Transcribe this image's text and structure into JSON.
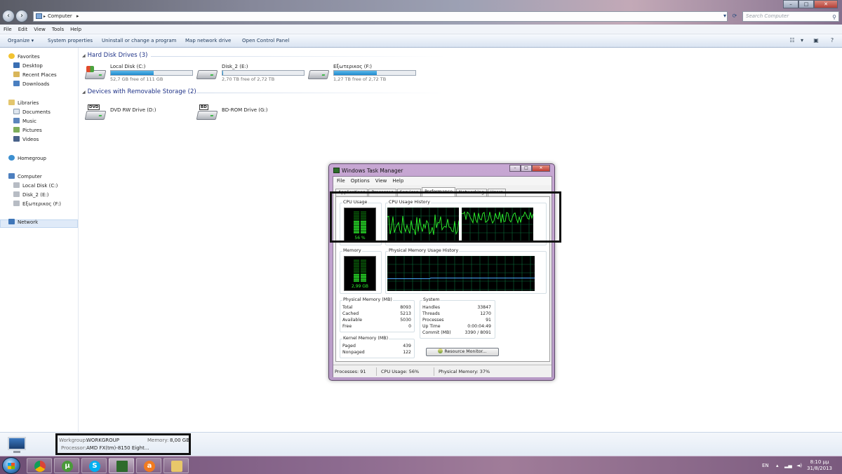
{
  "explorer": {
    "address": "Computer",
    "search_placeholder": "Search Computer",
    "menu": [
      "File",
      "Edit",
      "View",
      "Tools",
      "Help"
    ],
    "toolbar": {
      "organize": "Organize ▾",
      "system_properties": "System properties",
      "uninstall": "Uninstall or change a program",
      "map_drive": "Map network drive",
      "control_panel": "Open Control Panel"
    },
    "nav": {
      "favorites": "Favorites",
      "desktop": "Desktop",
      "recent": "Recent Places",
      "downloads": "Downloads",
      "libraries": "Libraries",
      "documents": "Documents",
      "music": "Music",
      "pictures": "Pictures",
      "videos": "Videos",
      "homegroup": "Homegroup",
      "computer": "Computer",
      "local_disk": "Local Disk (C:)",
      "disk2": "Disk_2 (E:)",
      "external": "Εξωτερικος (F:)",
      "network": "Network"
    },
    "groups": {
      "hdd": "Hard Disk Drives (3)",
      "removable": "Devices with Removable Storage (2)"
    },
    "drives": [
      {
        "name": "Local Disk (C:)",
        "free": "52,7 GB free of 111 GB",
        "used_fraction": 0.53
      },
      {
        "name": "Disk_2 (E:)",
        "free": "2,70 TB free of 2,72 TB",
        "used_fraction": 0.01
      },
      {
        "name": "Εξωτερικος (F:)",
        "free": "1,27 TB free of 2,72 TB",
        "used_fraction": 0.53
      }
    ],
    "removable": [
      {
        "name": "DVD RW Drive (D:)",
        "badge": "DVD"
      },
      {
        "name": "BD-ROM Drive (G:)",
        "badge": "BD"
      }
    ],
    "details": {
      "workgroup_label": "Workgroup:",
      "workgroup": "WORKGROUP",
      "memory_label": "Memory:",
      "memory": "8,00 GB",
      "processor_label": "Processor:",
      "processor": "AMD FX(tm)-8150 Eight..."
    }
  },
  "taskmgr": {
    "title": "Windows Task Manager",
    "menu": [
      "File",
      "Options",
      "View",
      "Help"
    ],
    "tabs": [
      "Applications",
      "Processes",
      "Services",
      "Performance",
      "Networking",
      "Users"
    ],
    "active_tab": "Performance",
    "cpu_usage_title": "CPU Usage",
    "cpu_usage_value": "56 %",
    "cpu_usage_fraction": 0.56,
    "cpu_history_title": "CPU Usage History",
    "memory_title": "Memory",
    "memory_value": "2,99 GB",
    "memory_fraction": 0.37,
    "phys_history_title": "Physical Memory Usage History",
    "physical_memory": {
      "title": "Physical Memory (MB)",
      "rows": [
        {
          "k": "Total",
          "v": "8093"
        },
        {
          "k": "Cached",
          "v": "5213"
        },
        {
          "k": "Available",
          "v": "5030"
        },
        {
          "k": "Free",
          "v": "0"
        }
      ]
    },
    "kernel_memory": {
      "title": "Kernel Memory (MB)",
      "rows": [
        {
          "k": "Paged",
          "v": "439"
        },
        {
          "k": "Nonpaged",
          "v": "122"
        }
      ]
    },
    "system": {
      "title": "System",
      "rows": [
        {
          "k": "Handles",
          "v": "33847"
        },
        {
          "k": "Threads",
          "v": "1270"
        },
        {
          "k": "Processes",
          "v": "91"
        },
        {
          "k": "Up Time",
          "v": "0:00:04:49"
        },
        {
          "k": "Commit (MB)",
          "v": "3390 / 8091"
        }
      ]
    },
    "resource_monitor": "Resource Monitor...",
    "status": {
      "processes": "Processes: 91",
      "cpu": "CPU Usage: 56%",
      "memory": "Physical Memory: 37%"
    }
  },
  "taskbar": {
    "lang": "EN",
    "time": "8:10 μμ",
    "date": "31/8/2013"
  }
}
